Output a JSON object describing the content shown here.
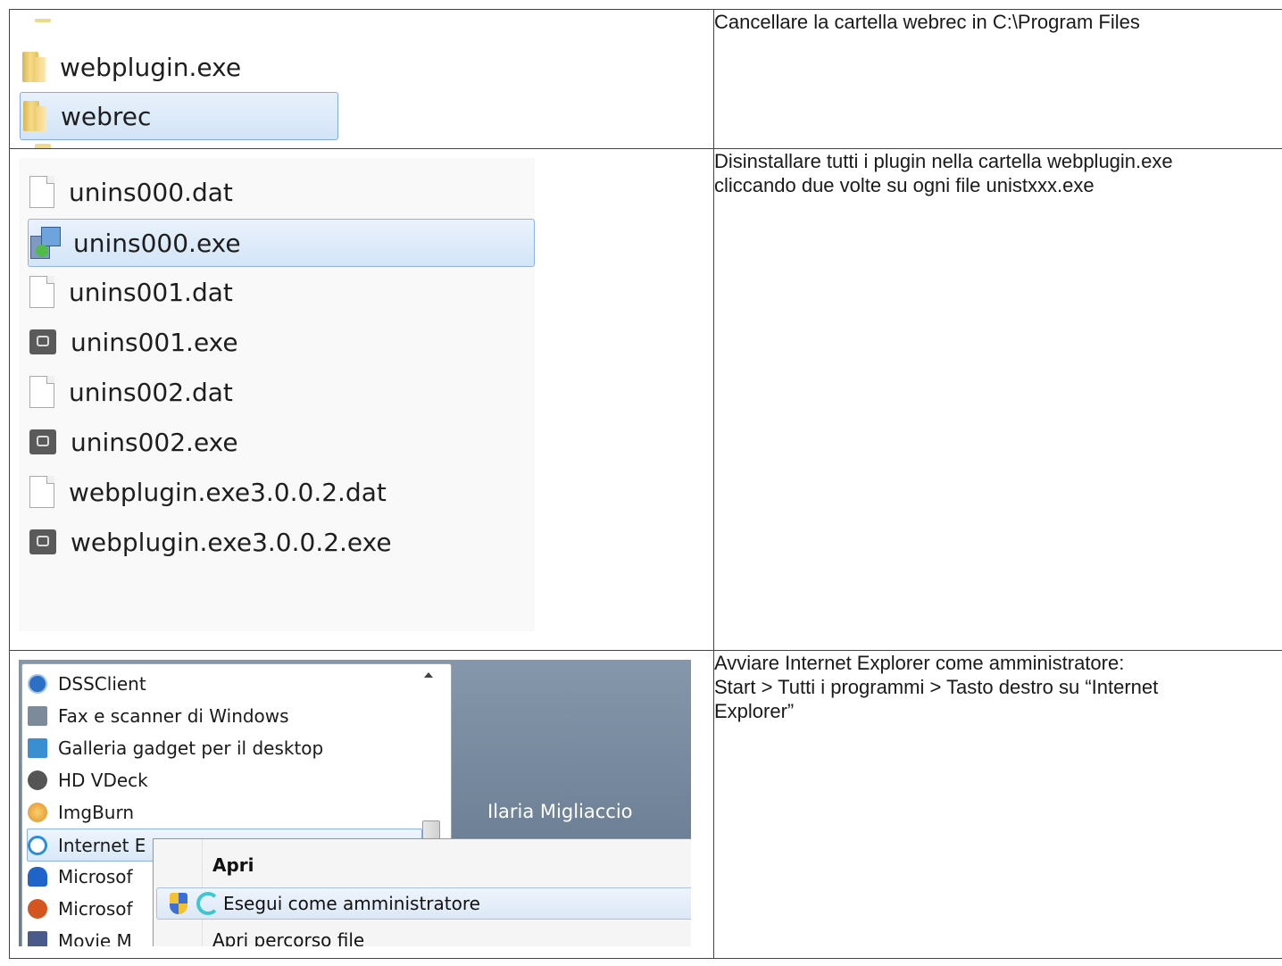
{
  "rows": [
    {
      "explorer": {
        "items": [
          {
            "name": "webplugin.exe",
            "type": "folder"
          },
          {
            "name": "webrec",
            "type": "folder",
            "selected": true
          }
        ]
      },
      "instruction": [
        "Cancellare la cartella webrec in C:\\Program Files"
      ]
    },
    {
      "explorer": {
        "files": [
          {
            "name": "unins000.dat",
            "icon": "document-icon"
          },
          {
            "name": "unins000.exe",
            "icon": "setup-icon",
            "selected": true
          },
          {
            "name": "unins001.dat",
            "icon": "document-icon"
          },
          {
            "name": "unins001.exe",
            "icon": "executable-icon"
          },
          {
            "name": "unins002.dat",
            "icon": "document-icon"
          },
          {
            "name": "unins002.exe",
            "icon": "executable-icon"
          },
          {
            "name": "webplugin.exe3.0.0.2.dat",
            "icon": "document-icon"
          },
          {
            "name": "webplugin.exe3.0.0.2.exe",
            "icon": "executable-icon"
          }
        ]
      },
      "instruction": [
        "Disinstallare tutti i plugin nella cartella webplugin.exe",
        "cliccando due volte su ogni file unistxxx.exe"
      ]
    },
    {
      "start_menu": {
        "programs": [
          {
            "name": "DSSClient",
            "icon_color": "#2d6fc4"
          },
          {
            "name": "Fax e scanner di Windows",
            "icon_color": "#7d8a99"
          },
          {
            "name": "Galleria gadget per il desktop",
            "icon_color": "#3a8fd1"
          },
          {
            "name": "HD VDeck",
            "icon_color": "#555555"
          },
          {
            "name": "ImgBurn",
            "icon_color": "#e0902c"
          },
          {
            "name": "Internet E",
            "icon_color": "#2c8fd6",
            "selected": true
          },
          {
            "name": "Microsof",
            "icon_color": "#1f64c8"
          },
          {
            "name": "Microsof",
            "icon_color": "#d4551f"
          },
          {
            "name": "Movie M",
            "icon_color": "#4a5a8a"
          }
        ],
        "user_name": "Ilaria Migliaccio",
        "context_menu": [
          {
            "label": "Apri",
            "bold": true
          },
          {
            "label": "Esegui come amministratore",
            "highlighted": true
          },
          {
            "label": "Apri percorso file"
          }
        ]
      },
      "instruction": [
        "Avviare Internet Explorer come amministratore:",
        "Start > Tutti i programmi > Tasto destro su “Internet",
        "Explorer”"
      ]
    }
  ]
}
